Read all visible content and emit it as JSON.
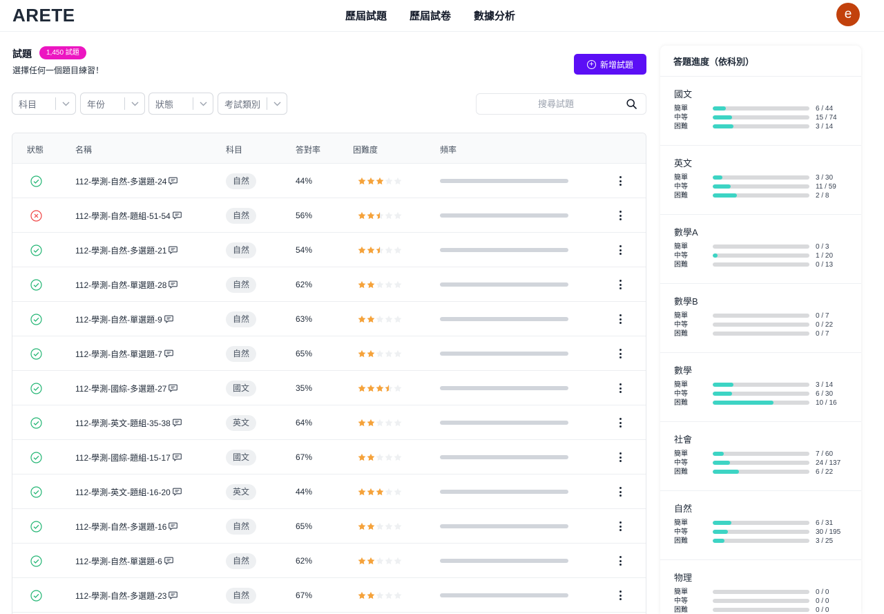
{
  "header": {
    "logo": "ARETE",
    "nav": [
      "歷屆試題",
      "歷屆試卷",
      "數據分析"
    ],
    "avatar_letter": "e"
  },
  "page": {
    "title": "試題",
    "count_badge": "1,450 試題",
    "subtitle": "選擇任何一個題目練習！",
    "add_button": "新增試題"
  },
  "filters": [
    "科目",
    "年份",
    "狀態",
    "考試類別"
  ],
  "search": {
    "placeholder": "搜尋試題",
    "icon": "search-icon"
  },
  "table": {
    "columns": [
      "狀態",
      "名稱",
      "科目",
      "答對率",
      "困難度",
      "頻率"
    ],
    "rows": [
      {
        "status": "correct",
        "name": "112-學測-自然-多選題-24",
        "subject": "自然",
        "rate": "44%",
        "stars": 3,
        "frequency": 0
      },
      {
        "status": "wrong",
        "name": "112-學測-自然-題組-51-54",
        "subject": "自然",
        "rate": "56%",
        "stars": 2.5,
        "frequency": 0
      },
      {
        "status": "correct",
        "name": "112-學測-自然-多選題-21",
        "subject": "自然",
        "rate": "54%",
        "stars": 2.5,
        "frequency": 0
      },
      {
        "status": "correct",
        "name": "112-學測-自然-單選題-28",
        "subject": "自然",
        "rate": "62%",
        "stars": 2,
        "frequency": 0
      },
      {
        "status": "correct",
        "name": "112-學測-自然-單選題-9",
        "subject": "自然",
        "rate": "63%",
        "stars": 2,
        "frequency": 0
      },
      {
        "status": "correct",
        "name": "112-學測-自然-單選題-7",
        "subject": "自然",
        "rate": "65%",
        "stars": 2,
        "frequency": 0
      },
      {
        "status": "correct",
        "name": "112-學測-國綜-多選題-27",
        "subject": "國文",
        "rate": "35%",
        "stars": 3.5,
        "frequency": 0
      },
      {
        "status": "correct",
        "name": "112-學測-英文-題組-35-38",
        "subject": "英文",
        "rate": "64%",
        "stars": 2,
        "frequency": 0
      },
      {
        "status": "correct",
        "name": "112-學測-國綜-題組-15-17",
        "subject": "國文",
        "rate": "67%",
        "stars": 2,
        "frequency": 0
      },
      {
        "status": "correct",
        "name": "112-學測-英文-題組-16-20",
        "subject": "英文",
        "rate": "44%",
        "stars": 3,
        "frequency": 0
      },
      {
        "status": "correct",
        "name": "112-學測-自然-多選題-16",
        "subject": "自然",
        "rate": "65%",
        "stars": 2,
        "frequency": 0
      },
      {
        "status": "correct",
        "name": "112-學測-自然-單選題-6",
        "subject": "自然",
        "rate": "62%",
        "stars": 2,
        "frequency": 0
      },
      {
        "status": "correct",
        "name": "112-學測-自然-多選題-23",
        "subject": "自然",
        "rate": "67%",
        "stars": 2,
        "frequency": 0
      }
    ]
  },
  "progress": {
    "title": "答題進度（依科別）",
    "subjects": [
      {
        "name": "國文",
        "levels": [
          {
            "label": "簡單",
            "done": 6,
            "total": 44,
            "count": "6 / 44"
          },
          {
            "label": "中等",
            "done": 15,
            "total": 74,
            "count": "15 / 74"
          },
          {
            "label": "困難",
            "done": 3,
            "total": 14,
            "count": "3 / 14"
          }
        ]
      },
      {
        "name": "英文",
        "levels": [
          {
            "label": "簡單",
            "done": 3,
            "total": 30,
            "count": "3 / 30"
          },
          {
            "label": "中等",
            "done": 11,
            "total": 59,
            "count": "11 / 59"
          },
          {
            "label": "困難",
            "done": 2,
            "total": 8,
            "count": "2 / 8"
          }
        ]
      },
      {
        "name": "數學A",
        "levels": [
          {
            "label": "簡單",
            "done": 0,
            "total": 3,
            "count": "0 / 3"
          },
          {
            "label": "中等",
            "done": 1,
            "total": 20,
            "count": "1 / 20"
          },
          {
            "label": "困難",
            "done": 0,
            "total": 13,
            "count": "0 / 13"
          }
        ]
      },
      {
        "name": "數學B",
        "levels": [
          {
            "label": "簡單",
            "done": 0,
            "total": 7,
            "count": "0 / 7"
          },
          {
            "label": "中等",
            "done": 0,
            "total": 22,
            "count": "0 / 22"
          },
          {
            "label": "困難",
            "done": 0,
            "total": 7,
            "count": "0 / 7"
          }
        ]
      },
      {
        "name": "數學",
        "levels": [
          {
            "label": "簡單",
            "done": 3,
            "total": 14,
            "count": "3 / 14"
          },
          {
            "label": "中等",
            "done": 6,
            "total": 30,
            "count": "6 / 30"
          },
          {
            "label": "困難",
            "done": 10,
            "total": 16,
            "count": "10 / 16"
          }
        ]
      },
      {
        "name": "社會",
        "levels": [
          {
            "label": "簡單",
            "done": 7,
            "total": 60,
            "count": "7 / 60"
          },
          {
            "label": "中等",
            "done": 24,
            "total": 137,
            "count": "24 / 137"
          },
          {
            "label": "困難",
            "done": 6,
            "total": 22,
            "count": "6 / 22"
          }
        ]
      },
      {
        "name": "自然",
        "levels": [
          {
            "label": "簡單",
            "done": 6,
            "total": 31,
            "count": "6 / 31"
          },
          {
            "label": "中等",
            "done": 30,
            "total": 195,
            "count": "30 / 195"
          },
          {
            "label": "困難",
            "done": 3,
            "total": 25,
            "count": "3 / 25"
          }
        ]
      },
      {
        "name": "物理",
        "levels": [
          {
            "label": "簡單",
            "done": 0,
            "total": 0,
            "count": "0 / 0"
          },
          {
            "label": "中等",
            "done": 0,
            "total": 0,
            "count": "0 / 0"
          },
          {
            "label": "困難",
            "done": 0,
            "total": 0,
            "count": "0 / 0"
          }
        ]
      }
    ]
  },
  "colors": {
    "accent": "#5b0ff5",
    "badge": "#ec16c1",
    "avatar": "#c2410c",
    "correct": "#22b573",
    "wrong": "#ef4444",
    "star": "#f5a23a",
    "progress": "#3dd4c4"
  }
}
